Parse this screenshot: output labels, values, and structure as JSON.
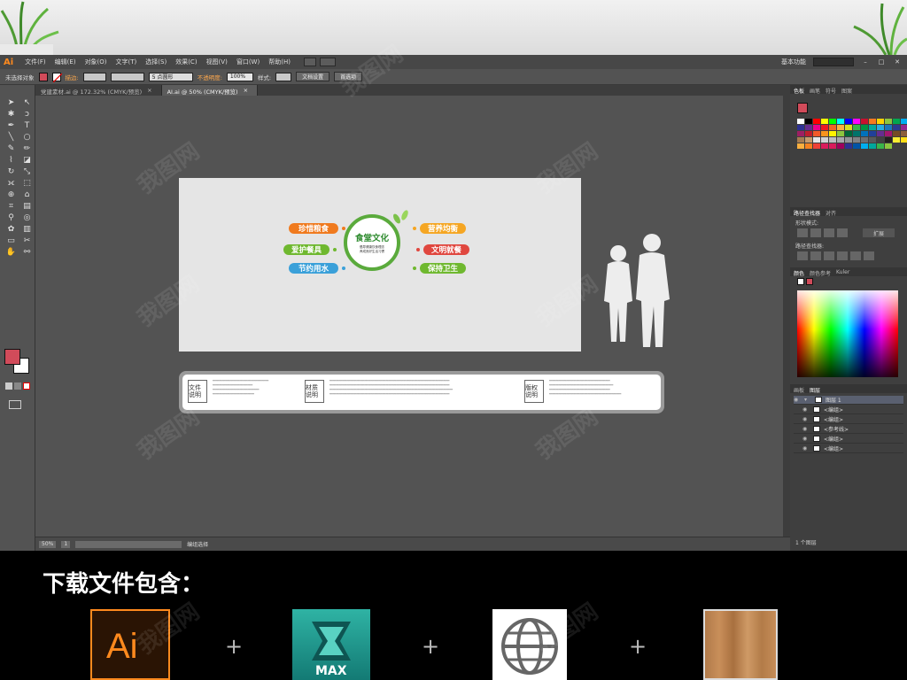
{
  "menubar": {
    "app": "Ai",
    "items": [
      "文件(F)",
      "编辑(E)",
      "对象(O)",
      "文字(T)",
      "选择(S)",
      "效果(C)",
      "视图(V)",
      "窗口(W)",
      "帮助(H)"
    ],
    "workspace": "基本功能"
  },
  "control": {
    "selection": "未选择对象",
    "stroke_label": "描边:",
    "brush_value": "5 点圆形",
    "opacity_label": "不透明度:",
    "opacity_value": "100%",
    "style_label": "样式:",
    "doc_setup": "文档设置",
    "preferences": "首选项"
  },
  "tabs": [
    {
      "label": "党建素材.ai @ 172.32% (CMYK/预览)",
      "close": "×"
    },
    {
      "label": "AI.ai @ 50% (CMYK/预览)",
      "close": "×"
    }
  ],
  "design": {
    "center_title": "食堂文化",
    "center_sub1": "倡导健康饮食理念",
    "center_sub2": "养成良好生活习惯",
    "pills_left": [
      "珍惜粮食",
      "爱护餐具",
      "节约用水"
    ],
    "pills_right": [
      "营养均衡",
      "文明就餐",
      "保持卫生"
    ],
    "info_boxes": [
      "文件说明",
      "材质说明",
      "版权说明"
    ]
  },
  "status": {
    "zoom": "50%",
    "page": "1",
    "mode": "编组选择"
  },
  "panels": {
    "swatch_tabs": [
      "色板",
      "画笔",
      "符号",
      "图案"
    ],
    "pathfinder_tabs": [
      "路径查找器",
      "对齐"
    ],
    "shape_mode": "形状模式:",
    "pathfinder": "路径查找器:",
    "expand": "扩展",
    "color_tabs": [
      "颜色",
      "颜色参考",
      "Kuler"
    ],
    "layer_tabs": [
      "画板",
      "图层"
    ],
    "layers": [
      "图层 1",
      "<编组>",
      "<编组>",
      "<参考线>",
      "<编组>",
      "<编组>"
    ],
    "layer_count": "1 个图层"
  },
  "bottom": {
    "title": "下载文件包含：",
    "ai_label": "Ai",
    "max_label": "MAX",
    "plus": "+"
  },
  "watermark": "我图网",
  "colors": {
    "pill_orange": "#f07a1e",
    "pill_green": "#6fb82f",
    "pill_blue": "#3aa0d9",
    "pill_red": "#e0473f",
    "ai_orange": "#ff8a1e"
  }
}
